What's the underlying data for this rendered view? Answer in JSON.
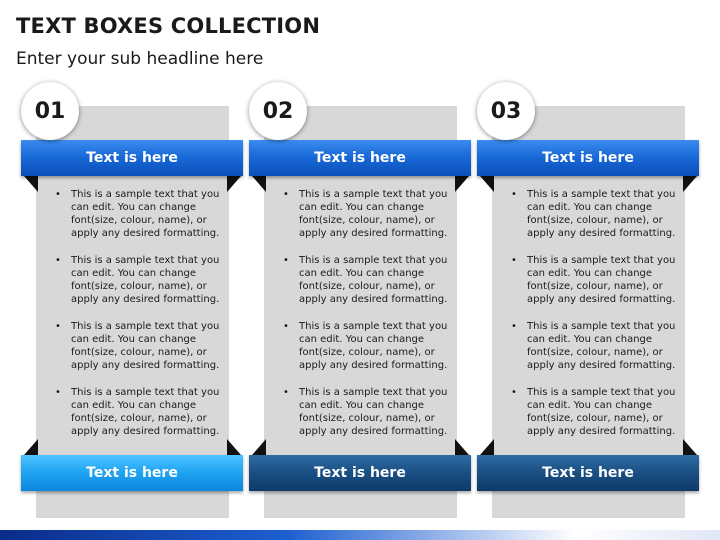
{
  "slide": {
    "title": "TEXT BOXES COLLECTION",
    "subtitle": "Enter your sub headline here"
  },
  "columns": [
    {
      "number": "01",
      "top_label": "Text is here",
      "bottom_label": "Text is here",
      "bottom_style": "light",
      "bullets": [
        "This is a sample text that you can edit. You can change font(size, colour, name), or apply any desired formatting.",
        "This is a sample text that you can edit. You can change font(size, colour, name), or apply any desired formatting.",
        "This is a sample text that you can edit. You can change font(size, colour, name), or apply any desired formatting.",
        "This is a sample text that you can edit. You can change font(size, colour, name), or apply any desired formatting."
      ]
    },
    {
      "number": "02",
      "top_label": "Text is here",
      "bottom_label": "Text is here",
      "bottom_style": "dark",
      "bullets": [
        "This is a sample text that you can edit. You can change font(size, colour, name), or apply any desired formatting.",
        "This is a sample text that you can edit. You can change font(size, colour, name), or apply any desired formatting.",
        "This is a sample text that you can edit. You can change font(size, colour, name), or apply any desired formatting.",
        "This is a sample text that you can edit. You can change font(size, colour, name), or apply any desired formatting."
      ]
    },
    {
      "number": "03",
      "top_label": "Text is here",
      "bottom_label": "Text is here",
      "bottom_style": "dark",
      "bullets": [
        "This is a sample text that you can edit. You can change font(size, colour, name), or apply any desired formatting.",
        "This is a sample text that you can edit. You can change font(size, colour, name), or apply any desired formatting.",
        "This is a sample text that you can edit. You can change font(size, colour, name), or apply any desired formatting.",
        "This is a sample text that you can edit. You can change font(size, colour, name), or apply any desired formatting."
      ]
    }
  ],
  "colors": {
    "ribbon_blue": "#1767d6",
    "ribbon_light_blue": "#1ea2f2",
    "ribbon_dark_blue": "#1a4f84",
    "panel_gray": "#d8d8d8"
  }
}
